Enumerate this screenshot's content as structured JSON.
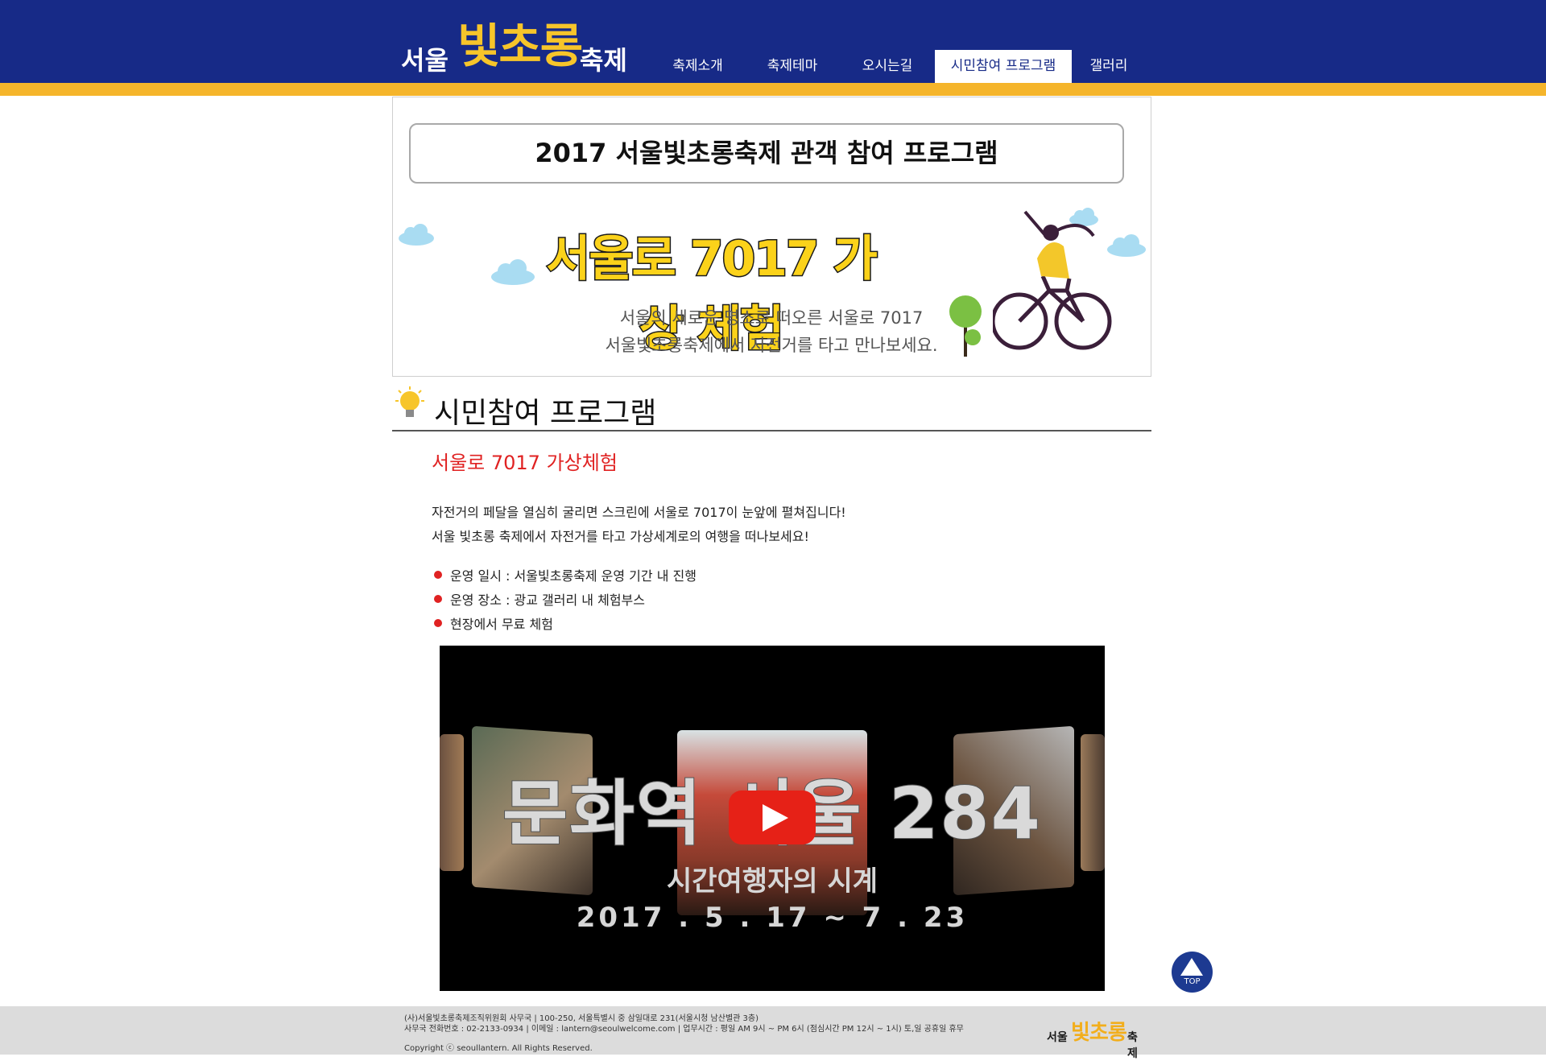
{
  "header": {
    "logo": {
      "part1": "서울",
      "part2": "빛초롱",
      "part3": "축제"
    },
    "nav": [
      {
        "label": "축제소개",
        "active": false
      },
      {
        "label": "축제테마",
        "active": false
      },
      {
        "label": "오시는길",
        "active": false
      },
      {
        "label": "시민참여 프로그램",
        "active": true
      },
      {
        "label": "갤러리",
        "active": false
      }
    ]
  },
  "banner": {
    "title": "2017 서울빛초롱축제 관객 참여 프로그램",
    "headline": "서울로 7017 가상 체험",
    "line1": "서울의 새로운 명소로 떠오른 서울로 7017",
    "line2": "서울빛초롱축제에서 자전거를 타고 만나보세요."
  },
  "section": {
    "title": "시민참여 프로그램"
  },
  "program": {
    "title": "서울로 7017 가상체험",
    "para1": "자전거의 페달을 열심히 굴리면 스크린에 서울로 7017이 눈앞에 펼쳐집니다!",
    "para2": "서울 빛초롱 축제에서 자전거를 타고 가상세계로의 여행을 떠나보세요!",
    "bullets": [
      "운영 일시 : 서울빛초롱축제 운영 기간 내 진행",
      "운영 장소 : 광교 갤러리 내 체험부스",
      "현장에서 무료 체험"
    ]
  },
  "video": {
    "title": "문화역 서울 284",
    "subtitle": "시간여행자의 시계",
    "date": "2017 . 5 . 17 ~ 7 . 23"
  },
  "top_button": {
    "label": "TOP"
  },
  "footer": {
    "line1": "(사)서울빛초롱축제조직위원회 사무국 | 100-250, 서울특별시 중 삼일대로 231(서울시청 남산별관 3층)",
    "line2": "사무국 전화번호 : 02-2133-0934 | 이메일 : lantern@seoulwelcome.com | 업무시간 : 평일 AM 9시 ~ PM 6시 (점심시간 PM 12시 ~ 1시) 토,일 공휴일 휴무",
    "copyright": "Copyright ⓒ seoullantern. All Rights Reserved.",
    "logo": {
      "part1": "서울",
      "part2": "빛초롱",
      "part3": "축제"
    }
  },
  "colors": {
    "header": "#172a87",
    "stripe": "#f5b52b",
    "accent_red": "#e02222",
    "youtube_red": "#e62117"
  },
  "icons": [
    "bulb-icon",
    "play-icon",
    "top-arrow-icon",
    "bicycle-icon",
    "cloud-icon",
    "tree-icon"
  ]
}
